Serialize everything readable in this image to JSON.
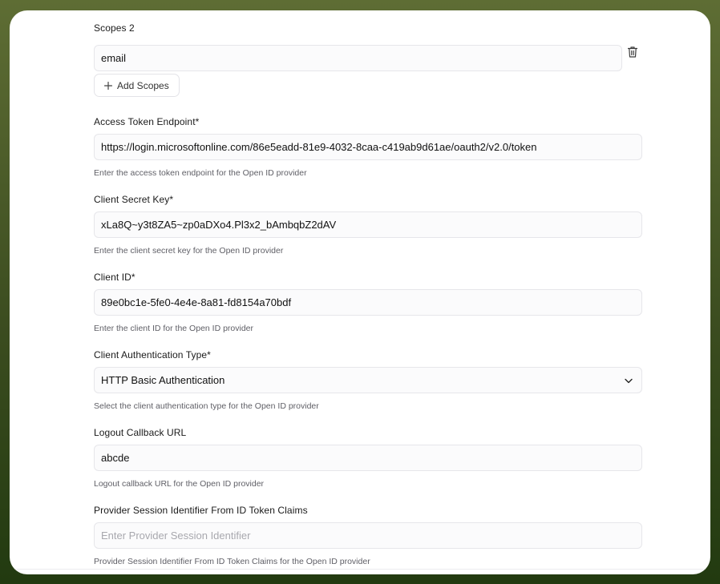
{
  "scopes": {
    "label": "Scopes 2",
    "value": "email",
    "add_label": "Add Scopes"
  },
  "access_token": {
    "label": "Access Token Endpoint*",
    "value": "https://login.microsoftonline.com/86e5eadd-81e9-4032-8caa-c419ab9d61ae/oauth2/v2.0/token",
    "hint": "Enter the access token endpoint for the Open ID provider"
  },
  "client_secret": {
    "label": "Client Secret Key*",
    "value": "xLa8Q~y3t8ZA5~zp0aDXo4.Pl3x2_bAmbqbZ2dAV",
    "hint": "Enter the client secret key for the Open ID provider"
  },
  "client_id": {
    "label": "Client ID*",
    "value": "89e0bc1e-5fe0-4e4e-8a81-fd8154a70bdf",
    "hint": "Enter the client ID for the Open ID provider"
  },
  "client_auth_type": {
    "label": "Client Authentication Type*",
    "value": "HTTP Basic Authentication",
    "hint": "Select the client authentication type for the Open ID provider"
  },
  "logout_callback": {
    "label": "Logout Callback URL",
    "value": "abcde",
    "hint": "Logout callback URL for the Open ID provider"
  },
  "provider_session": {
    "label": "Provider Session Identifier From ID Token Claims",
    "placeholder": "Enter Provider Session Identifier",
    "hint": "Provider Session Identifier From ID Token Claims for the Open ID provider"
  },
  "icons": {
    "delete": "trash-icon",
    "add": "plus-icon",
    "dropdown": "chevron-down-icon"
  }
}
